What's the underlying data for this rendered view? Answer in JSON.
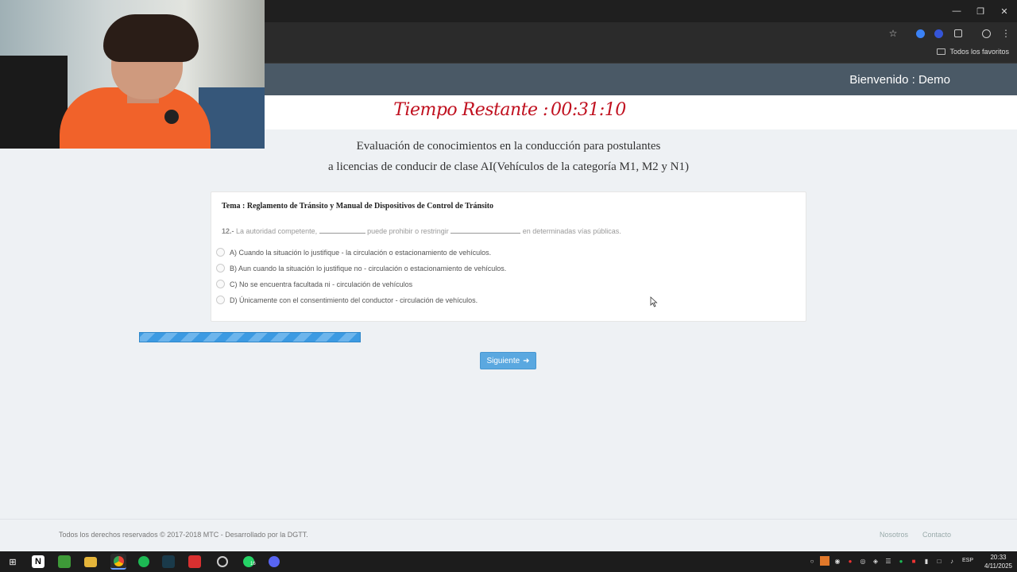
{
  "browser": {
    "bookmarks_label": "Todos los favoritos",
    "window_controls": [
      "minimize-icon",
      "restore-icon",
      "close-icon"
    ],
    "toolbar_icons": [
      "star-icon",
      "extension-blue-icon",
      "extension-blue2-icon",
      "puzzle-icon",
      "profile-icon",
      "menu-dots-icon"
    ]
  },
  "header": {
    "welcome": "Bienvenido : Demo",
    "timer_label": "Tiempo Restante :",
    "timer_value": "00:31:10"
  },
  "exam": {
    "title_line1": "Evaluación de conocimientos en la conducción para postulantes",
    "title_line2": "a licencias de conducir de clase AI(Vehículos de la categoría M1, M2 y N1)",
    "topic": "Tema : Reglamento de Tránsito y Manual de Dispositivos de Control de Tránsito",
    "question_number": "12.-",
    "question_part1": "La autoridad competente,",
    "question_part2": "puede prohibir o restringir",
    "question_part3": "en determinadas vías públicas.",
    "options": [
      "A) Cuando la situación lo justifique - la circulación o estacionamiento de vehículos.",
      "B) Aun cuando la situación lo justifique no - circulación o estacionamiento de vehículos.",
      "C) No se encuentra facultada ni - circulación de vehículos",
      "D) Únicamente con el consentimiento del conductor - circulación de vehículos."
    ],
    "progress_fraction": 0.33,
    "next_label": "Siguiente"
  },
  "footer": {
    "copyright": "Todos los derechos reservados © 2017-2018 MTC - Desarrollado por la DGTT.",
    "link_about": "Nosotros",
    "link_contact": "Contacto"
  },
  "taskbar": {
    "apps": [
      "windows-start-icon",
      "notion-icon",
      "minecraft-icon",
      "file-explorer-icon",
      "chrome-icon",
      "spotify-icon",
      "app-icon",
      "media-app-icon",
      "obs-icon",
      "whatsapp-icon",
      "discord-icon"
    ],
    "whatsapp_badge": "16",
    "language": "ESP",
    "time": "20:33",
    "date": "4/11/2025"
  },
  "colors": {
    "site_header": "#4a5966",
    "timer": "#c0101f",
    "button": "#5aa8e0",
    "progress": "#3c9ae2"
  }
}
